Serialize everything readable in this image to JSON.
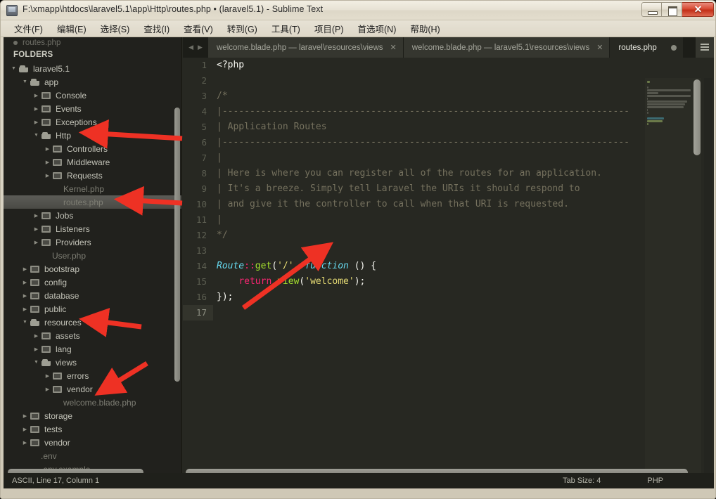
{
  "window": {
    "title": "F:\\xmapp\\htdocs\\laravel5.1\\app\\Http\\routes.php • (laravel5.1) - Sublime Text",
    "minimize_label": "—",
    "maximize_label": "□",
    "close_label": "✕"
  },
  "menubar": {
    "items": [
      {
        "label": "文件(F)"
      },
      {
        "label": "编辑(E)"
      },
      {
        "label": "选择(S)"
      },
      {
        "label": "查找(I)"
      },
      {
        "label": "查看(V)"
      },
      {
        "label": "转到(G)"
      },
      {
        "label": "工具(T)"
      },
      {
        "label": "项目(P)"
      },
      {
        "label": "首选项(N)"
      },
      {
        "label": "帮助(H)"
      }
    ]
  },
  "sidebar": {
    "open_file": "routes.php",
    "folders_header": "FOLDERS",
    "tree": [
      {
        "label": "laravel5.1",
        "indent": 0,
        "type": "folder",
        "state": "open",
        "selected": false
      },
      {
        "label": "app",
        "indent": 1,
        "type": "folder",
        "state": "open",
        "selected": false
      },
      {
        "label": "Console",
        "indent": 2,
        "type": "folder",
        "state": "closed",
        "selected": false
      },
      {
        "label": "Events",
        "indent": 2,
        "type": "folder",
        "state": "closed",
        "selected": false
      },
      {
        "label": "Exceptions",
        "indent": 2,
        "type": "folder",
        "state": "closed",
        "selected": false
      },
      {
        "label": "Http",
        "indent": 2,
        "type": "folder",
        "state": "open",
        "selected": false
      },
      {
        "label": "Controllers",
        "indent": 3,
        "type": "folder",
        "state": "closed",
        "selected": false
      },
      {
        "label": "Middleware",
        "indent": 3,
        "type": "folder",
        "state": "closed",
        "selected": false
      },
      {
        "label": "Requests",
        "indent": 3,
        "type": "folder",
        "state": "closed",
        "selected": false
      },
      {
        "label": "Kernel.php",
        "indent": 4,
        "type": "file",
        "state": "",
        "selected": false
      },
      {
        "label": "routes.php",
        "indent": 4,
        "type": "file",
        "state": "",
        "selected": true
      },
      {
        "label": "Jobs",
        "indent": 2,
        "type": "folder",
        "state": "closed",
        "selected": false
      },
      {
        "label": "Listeners",
        "indent": 2,
        "type": "folder",
        "state": "closed",
        "selected": false
      },
      {
        "label": "Providers",
        "indent": 2,
        "type": "folder",
        "state": "closed",
        "selected": false
      },
      {
        "label": "User.php",
        "indent": 3,
        "type": "file",
        "state": "",
        "selected": false
      },
      {
        "label": "bootstrap",
        "indent": 1,
        "type": "folder",
        "state": "closed",
        "selected": false
      },
      {
        "label": "config",
        "indent": 1,
        "type": "folder",
        "state": "closed",
        "selected": false
      },
      {
        "label": "database",
        "indent": 1,
        "type": "folder",
        "state": "closed",
        "selected": false
      },
      {
        "label": "public",
        "indent": 1,
        "type": "folder",
        "state": "closed",
        "selected": false
      },
      {
        "label": "resources",
        "indent": 1,
        "type": "folder",
        "state": "open",
        "selected": false
      },
      {
        "label": "assets",
        "indent": 2,
        "type": "folder",
        "state": "closed",
        "selected": false
      },
      {
        "label": "lang",
        "indent": 2,
        "type": "folder",
        "state": "closed",
        "selected": false
      },
      {
        "label": "views",
        "indent": 2,
        "type": "folder",
        "state": "open",
        "selected": false
      },
      {
        "label": "errors",
        "indent": 3,
        "type": "folder",
        "state": "closed",
        "selected": false
      },
      {
        "label": "vendor",
        "indent": 3,
        "type": "folder",
        "state": "closed",
        "selected": false
      },
      {
        "label": "welcome.blade.php",
        "indent": 4,
        "type": "file",
        "state": "",
        "selected": false
      },
      {
        "label": "storage",
        "indent": 1,
        "type": "folder",
        "state": "closed",
        "selected": false
      },
      {
        "label": "tests",
        "indent": 1,
        "type": "folder",
        "state": "closed",
        "selected": false
      },
      {
        "label": "vendor",
        "indent": 1,
        "type": "folder",
        "state": "closed",
        "selected": false
      },
      {
        "label": ".env",
        "indent": 2,
        "type": "file",
        "state": "",
        "selected": false
      },
      {
        "label": ".env.example",
        "indent": 2,
        "type": "file",
        "state": "",
        "selected": false
      }
    ]
  },
  "tabs": [
    {
      "label": "welcome.blade.php — laravel\\resources\\views",
      "active": false,
      "dirty": false,
      "close": "✕"
    },
    {
      "label": "welcome.blade.php — laravel5.1\\resources\\views",
      "active": false,
      "dirty": false,
      "close": "✕"
    },
    {
      "label": "routes.php",
      "active": true,
      "dirty": true,
      "close": ""
    }
  ],
  "editor": {
    "lines": [
      {
        "n": "1",
        "current": false,
        "tokens": [
          {
            "t": "<?php",
            "c": "pl"
          }
        ]
      },
      {
        "n": "2",
        "current": false,
        "tokens": []
      },
      {
        "n": "3",
        "current": false,
        "tokens": [
          {
            "t": "/*",
            "c": "cm"
          }
        ]
      },
      {
        "n": "4",
        "current": false,
        "tokens": [
          {
            "t": "|--------------------------------------------------------------------------",
            "c": "cm"
          }
        ]
      },
      {
        "n": "5",
        "current": false,
        "tokens": [
          {
            "t": "| Application Routes",
            "c": "cm"
          }
        ]
      },
      {
        "n": "6",
        "current": false,
        "tokens": [
          {
            "t": "|--------------------------------------------------------------------------",
            "c": "cm"
          }
        ]
      },
      {
        "n": "7",
        "current": false,
        "tokens": [
          {
            "t": "|",
            "c": "cm"
          }
        ]
      },
      {
        "n": "8",
        "current": false,
        "tokens": [
          {
            "t": "| Here is where you can register all of the routes for an application.",
            "c": "cm"
          }
        ]
      },
      {
        "n": "9",
        "current": false,
        "tokens": [
          {
            "t": "| It's a breeze. Simply tell Laravel the URIs it should respond to",
            "c": "cm"
          }
        ]
      },
      {
        "n": "10",
        "current": false,
        "tokens": [
          {
            "t": "| and give it the controller to call when that URI is requested.",
            "c": "cm"
          }
        ]
      },
      {
        "n": "11",
        "current": false,
        "tokens": [
          {
            "t": "|",
            "c": "cm"
          }
        ]
      },
      {
        "n": "12",
        "current": false,
        "tokens": [
          {
            "t": "*/",
            "c": "cm"
          }
        ]
      },
      {
        "n": "13",
        "current": false,
        "tokens": []
      },
      {
        "n": "14",
        "current": false,
        "tokens": [
          {
            "t": "Route",
            "c": "kw"
          },
          {
            "t": "::",
            "c": "op"
          },
          {
            "t": "get",
            "c": "fn"
          },
          {
            "t": "(",
            "c": "pl"
          },
          {
            "t": "'/'",
            "c": "str"
          },
          {
            "t": ", ",
            "c": "pl"
          },
          {
            "t": "function",
            "c": "kw"
          },
          {
            "t": " () {",
            "c": "pl"
          }
        ]
      },
      {
        "n": "15",
        "current": false,
        "tokens": [
          {
            "t": "    ",
            "c": "pl"
          },
          {
            "t": "return",
            "c": "ret"
          },
          {
            "t": " ",
            "c": "pl"
          },
          {
            "t": "view",
            "c": "fn"
          },
          {
            "t": "(",
            "c": "pl"
          },
          {
            "t": "'welcome'",
            "c": "str"
          },
          {
            "t": ");",
            "c": "pl"
          }
        ]
      },
      {
        "n": "16",
        "current": false,
        "tokens": [
          {
            "t": "});",
            "c": "pl"
          }
        ]
      },
      {
        "n": "17",
        "current": true,
        "tokens": []
      }
    ],
    "tab_menu_icon": "hamburger-menu-icon"
  },
  "statusbar": {
    "left": "ASCII, Line 17, Column 1",
    "tab_size": "Tab Size: 4",
    "syntax": "PHP"
  },
  "annotations": {
    "color": "#ee3124",
    "arrows": [
      {
        "name": "arrow-to-http-folder",
        "points": "to Http folder in sidebar"
      },
      {
        "name": "arrow-to-routes-php-file",
        "points": "to routes.php in sidebar"
      },
      {
        "name": "arrow-to-resources-folder",
        "points": "to resources folder in sidebar"
      },
      {
        "name": "arrow-to-welcome-blade-file",
        "points": "to welcome.blade.php in sidebar"
      },
      {
        "name": "arrow-to-welcome-string",
        "points": "to 'welcome' string in code"
      }
    ]
  }
}
